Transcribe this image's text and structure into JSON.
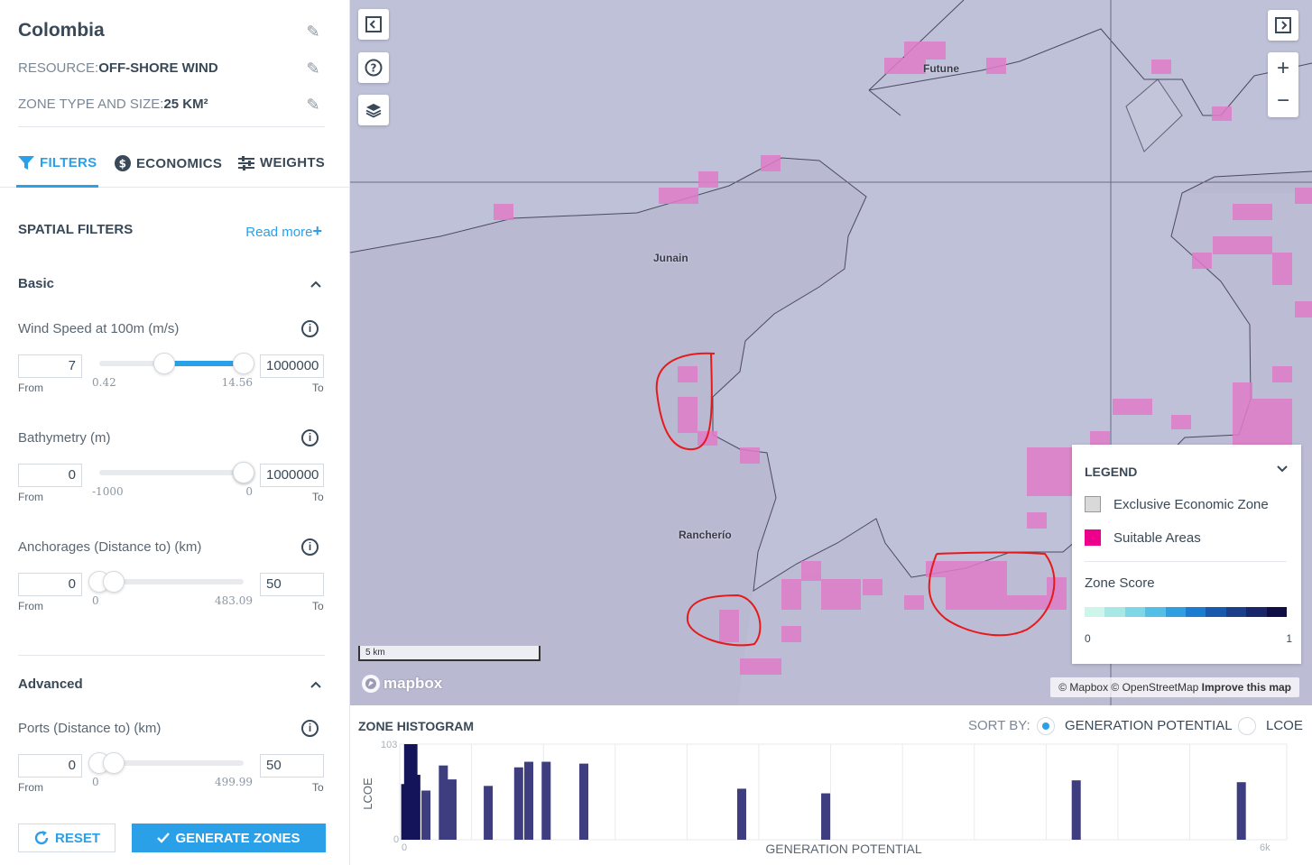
{
  "sidebar": {
    "title": "Colombia",
    "resource_label": "RESOURCE:",
    "resource_value": "OFF-SHORE WIND",
    "zone_label": "ZONE TYPE AND SIZE:",
    "zone_value": "25 KM²",
    "tabs": [
      {
        "label": "FILTERS",
        "icon": "filter-icon",
        "active": true
      },
      {
        "label": "ECONOMICS",
        "icon": "dollar-icon",
        "active": false
      },
      {
        "label": "WEIGHTS",
        "icon": "sliders-icon",
        "active": false
      }
    ],
    "spatial_filters": "SPATIAL FILTERS",
    "read_more": "Read more",
    "basic": "Basic",
    "advanced": "Advanced",
    "from_label": "From",
    "to_label": "To",
    "filters": [
      {
        "label": "Wind Speed at 100m (m/s)",
        "from": "7",
        "to": "1000000",
        "min": "0.42",
        "max": "14.56",
        "low_frac": 0.45,
        "high_frac": 1.0
      },
      {
        "label": "Bathymetry (m)",
        "from": "0",
        "to": "1000000",
        "min": "-1000",
        "max": "0",
        "low_frac": 1.0,
        "high_frac": 1.0
      },
      {
        "label": "Anchorages (Distance to) (km)",
        "from": "0",
        "to": "50",
        "min": "0",
        "max": "483.09",
        "low_frac": 0.0,
        "high_frac": 0.1
      },
      {
        "label": "Ports (Distance to) (km)",
        "from": "0",
        "to": "50",
        "min": "0",
        "max": "499.99",
        "low_frac": 0.0,
        "high_frac": 0.1
      }
    ],
    "reset_label": "RESET",
    "generate_label": "GENERATE ZONES"
  },
  "map": {
    "places": [
      "Futune",
      "Junain",
      "Rancherío"
    ],
    "scale_label": "5 km",
    "logo_text": "mapbox",
    "attribution": "© Mapbox © OpenStreetMap",
    "improve": "Improve this map",
    "colors": {
      "water": "#b9bad2",
      "land": "#c5c6dc",
      "suitable": "#e07bc8",
      "annotation": "#e8191c"
    }
  },
  "legend": {
    "title": "LEGEND",
    "items": [
      {
        "label": "Exclusive Economic Zone",
        "color": "#d9d9d9"
      },
      {
        "label": "Suitable Areas",
        "color": "#ec008c"
      }
    ],
    "zone_score": "Zone Score",
    "score_min": "0",
    "score_max": "1",
    "score_colors": [
      "#cdf5ea",
      "#a7e8e6",
      "#7fd6e6",
      "#54bfe6",
      "#2f9fe0",
      "#1b7cd0",
      "#1a5aae",
      "#1c3f8a",
      "#19266a",
      "#0f0f45"
    ]
  },
  "histogram": {
    "title": "ZONE HISTOGRAM",
    "sort_by": "SORT BY:",
    "option_gen": "GENERATION POTENTIAL",
    "option_lcoe": "LCOE",
    "ylabel": "LCOE",
    "xlabel": "GENERATION POTENTIAL",
    "y_max_label": "103",
    "y_min_label": "0",
    "x_min_label": "0",
    "x_max_label": "6k"
  },
  "chart_data": {
    "type": "bar",
    "xlabel": "GENERATION POTENTIAL",
    "ylabel": "LCOE",
    "xlim": [
      0,
      6000
    ],
    "ylim": [
      0,
      103
    ],
    "bars": [
      {
        "x": 10,
        "y": 60,
        "dark": true
      },
      {
        "x": 30,
        "y": 103,
        "dark": true
      },
      {
        "x": 60,
        "y": 103,
        "dark": true
      },
      {
        "x": 80,
        "y": 70,
        "dark": true
      },
      {
        "x": 150,
        "y": 53,
        "dark": false
      },
      {
        "x": 270,
        "y": 80,
        "dark": false
      },
      {
        "x": 330,
        "y": 65,
        "dark": false
      },
      {
        "x": 580,
        "y": 58,
        "dark": false
      },
      {
        "x": 790,
        "y": 78,
        "dark": false
      },
      {
        "x": 860,
        "y": 84,
        "dark": false
      },
      {
        "x": 980,
        "y": 84,
        "dark": false
      },
      {
        "x": 1240,
        "y": 82,
        "dark": false
      },
      {
        "x": 2330,
        "y": 55,
        "dark": false
      },
      {
        "x": 2910,
        "y": 50,
        "dark": false
      },
      {
        "x": 4640,
        "y": 64,
        "dark": false
      },
      {
        "x": 5780,
        "y": 62,
        "dark": false
      }
    ]
  }
}
